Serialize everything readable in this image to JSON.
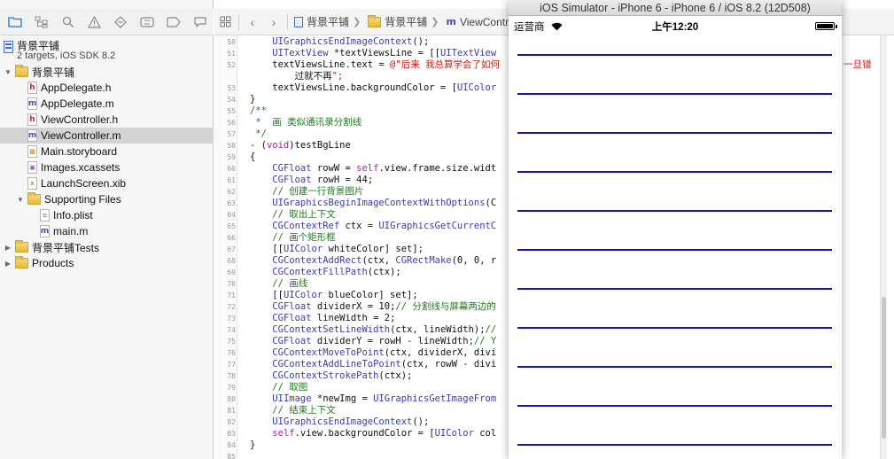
{
  "colors": {
    "divider": "#1515a8",
    "selected_row": "#d4d4d4",
    "comment": "#1f7a1f",
    "keyword": "#a8239c",
    "type": "#3b3bb0",
    "string": "#c41a16"
  },
  "navigator": {
    "toolbar_icons": [
      "folder-icon",
      "hierarchy-icon",
      "search-icon",
      "warning-icon",
      "test-diamond-icon",
      "debug-icon",
      "breakpoint-icon",
      "report-icon"
    ],
    "project_title": "背景平铺",
    "project_subtitle": "2 targets, iOS SDK 8.2",
    "tree": [
      {
        "label": "背景平铺",
        "kind": "folder",
        "depth": 0,
        "expanded": true
      },
      {
        "label": "AppDelegate.h",
        "kind": "h",
        "depth": 1
      },
      {
        "label": "AppDelegate.m",
        "kind": "m",
        "depth": 1
      },
      {
        "label": "ViewController.h",
        "kind": "h",
        "depth": 1
      },
      {
        "label": "ViewController.m",
        "kind": "m",
        "depth": 1,
        "selected": true
      },
      {
        "label": "Main.storyboard",
        "kind": "sb",
        "depth": 1
      },
      {
        "label": "Images.xcassets",
        "kind": "xc",
        "depth": 1
      },
      {
        "label": "LaunchScreen.xib",
        "kind": "xib",
        "depth": 1
      },
      {
        "label": "Supporting Files",
        "kind": "folder",
        "depth": 1,
        "expanded": true
      },
      {
        "label": "Info.plist",
        "kind": "plist",
        "depth": 2
      },
      {
        "label": "main.m",
        "kind": "m",
        "depth": 2
      },
      {
        "label": "背景平铺Tests",
        "kind": "folder",
        "depth": 0,
        "expanded": false
      },
      {
        "label": "Products",
        "kind": "folder",
        "depth": 0,
        "expanded": false
      }
    ]
  },
  "jump_bar": {
    "crumbs": [
      "背景平铺",
      "背景平铺",
      "ViewControlle"
    ]
  },
  "code": {
    "lines": [
      {
        "n": "50",
        "t": "    UIGraphicsEndImageContext();"
      },
      {
        "n": "51",
        "t": "    UITextView *textViewsLine = [[UITextView"
      },
      {
        "n": "52",
        "t": "    textViewsLine.text = @\"后来 我总算学会了如何"
      },
      {
        "n": "",
        "t": "        过就不再\";"
      },
      {
        "n": "53",
        "t": "    textViewsLine.backgroundColor = [UIColor"
      },
      {
        "n": "54",
        "t": "}"
      },
      {
        "n": "55",
        "t": "/**"
      },
      {
        "n": "56",
        "t": " *  画 类似通讯录分割线"
      },
      {
        "n": "57",
        "t": " */"
      },
      {
        "n": "58",
        "t": "- (void)testBgLine"
      },
      {
        "n": "59",
        "t": "{"
      },
      {
        "n": "60",
        "t": "    CGFloat rowW = self.view.frame.size.widt"
      },
      {
        "n": "61",
        "t": "    CGFloat rowH = 44;"
      },
      {
        "n": "62",
        "t": "    // 创建一行背景图片"
      },
      {
        "n": "63",
        "t": "    UIGraphicsBeginImageContextWithOptions(C"
      },
      {
        "n": "64",
        "t": "    // 取出上下文"
      },
      {
        "n": "65",
        "t": "    CGContextRef ctx = UIGraphicsGetCurrentC"
      },
      {
        "n": "66",
        "t": "    // 画个矩形框"
      },
      {
        "n": "67",
        "t": "    [[UIColor whiteColor] set];"
      },
      {
        "n": "68",
        "t": "    CGContextAddRect(ctx, CGRectMake(0, 0, r"
      },
      {
        "n": "69",
        "t": "    CGContextFillPath(ctx);"
      },
      {
        "n": "70",
        "t": "    // 画线"
      },
      {
        "n": "71",
        "t": "    [[UIColor blueColor] set];"
      },
      {
        "n": "72",
        "t": "    CGFloat dividerX = 10;// 分割线与屏幕两边的"
      },
      {
        "n": "73",
        "t": "    CGFloat lineWidth = 2;"
      },
      {
        "n": "74",
        "t": "    CGContextSetLineWidth(ctx, lineWidth);//"
      },
      {
        "n": "75",
        "t": "    CGFloat dividerY = rowH - lineWidth;// Y"
      },
      {
        "n": "76",
        "t": "    CGContextMoveToPoint(ctx, dividerX, divi"
      },
      {
        "n": "77",
        "t": "    CGContextAddLineToPoint(ctx, rowW - divi"
      },
      {
        "n": "78",
        "t": "    CGContextStrokePath(ctx);"
      },
      {
        "n": "79",
        "t": "    // 取图"
      },
      {
        "n": "80",
        "t": "    UIImage *newImg = UIGraphicsGetImageFrom"
      },
      {
        "n": "81",
        "t": "    // 结束上下文"
      },
      {
        "n": "82",
        "t": "    UIGraphicsEndImageContext();"
      },
      {
        "n": "83",
        "t": "    self.view.backgroundColor = [UIColor col"
      },
      {
        "n": "84",
        "t": "}"
      },
      {
        "n": "85",
        "t": ""
      }
    ],
    "overflow_right_line52": "一旦错"
  },
  "simulator": {
    "title": "iOS Simulator - iPhone 6 - iPhone 6 / iOS 8.2 (12D508)",
    "carrier": "运营商",
    "time": "上午12:20",
    "divider_count": 11
  }
}
